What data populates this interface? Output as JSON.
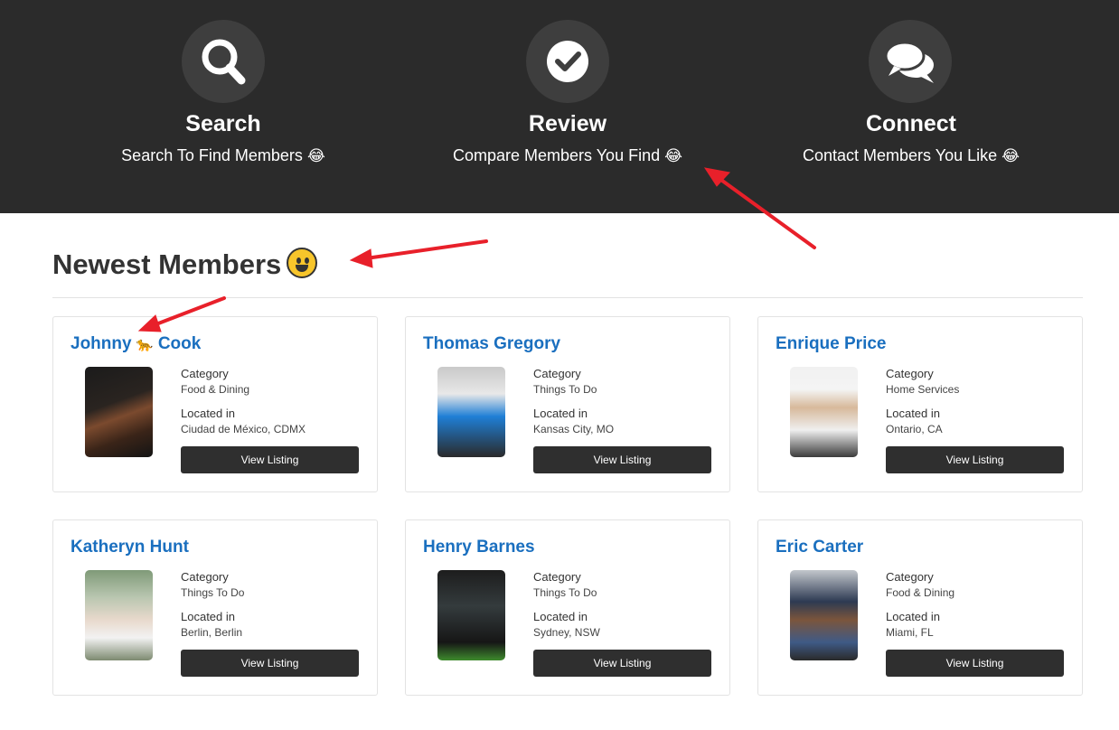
{
  "features": [
    {
      "icon": "search-icon",
      "title": "Search",
      "description": "Search To Find Members",
      "emoji": "😂"
    },
    {
      "icon": "check-circle-icon",
      "title": "Review",
      "description": "Compare Members You Find",
      "emoji": "😂"
    },
    {
      "icon": "chat-bubbles-icon",
      "title": "Connect",
      "description": "Contact Members You Like",
      "emoji": "😂"
    }
  ],
  "newest": {
    "title": "Newest Members",
    "emoji_icon": "grinning-face-icon"
  },
  "labels": {
    "category": "Category",
    "located_in": "Located in",
    "view_listing": "View Listing"
  },
  "members": [
    {
      "first": "Johnny",
      "emoji": "🐆",
      "last": "Cook",
      "category": "Food & Dining",
      "location": "Ciudad de México, CDMX"
    },
    {
      "name": "Thomas Gregory",
      "category": "Things To Do",
      "location": "Kansas City, MO"
    },
    {
      "name": "Enrique Price",
      "category": "Home Services",
      "location": "Ontario, CA"
    },
    {
      "name": "Katheryn Hunt",
      "category": "Things To Do",
      "location": "Berlin, Berlin"
    },
    {
      "name": "Henry Barnes",
      "category": "Things To Do",
      "location": "Sydney, NSW"
    },
    {
      "name": "Eric Carter",
      "category": "Food & Dining",
      "location": "Miami, FL"
    }
  ],
  "colors": {
    "hero_bg": "#2b2b2b",
    "link": "#1a6fbf",
    "button_bg": "#2f2f2f",
    "annotation_arrow": "#e8202a"
  }
}
